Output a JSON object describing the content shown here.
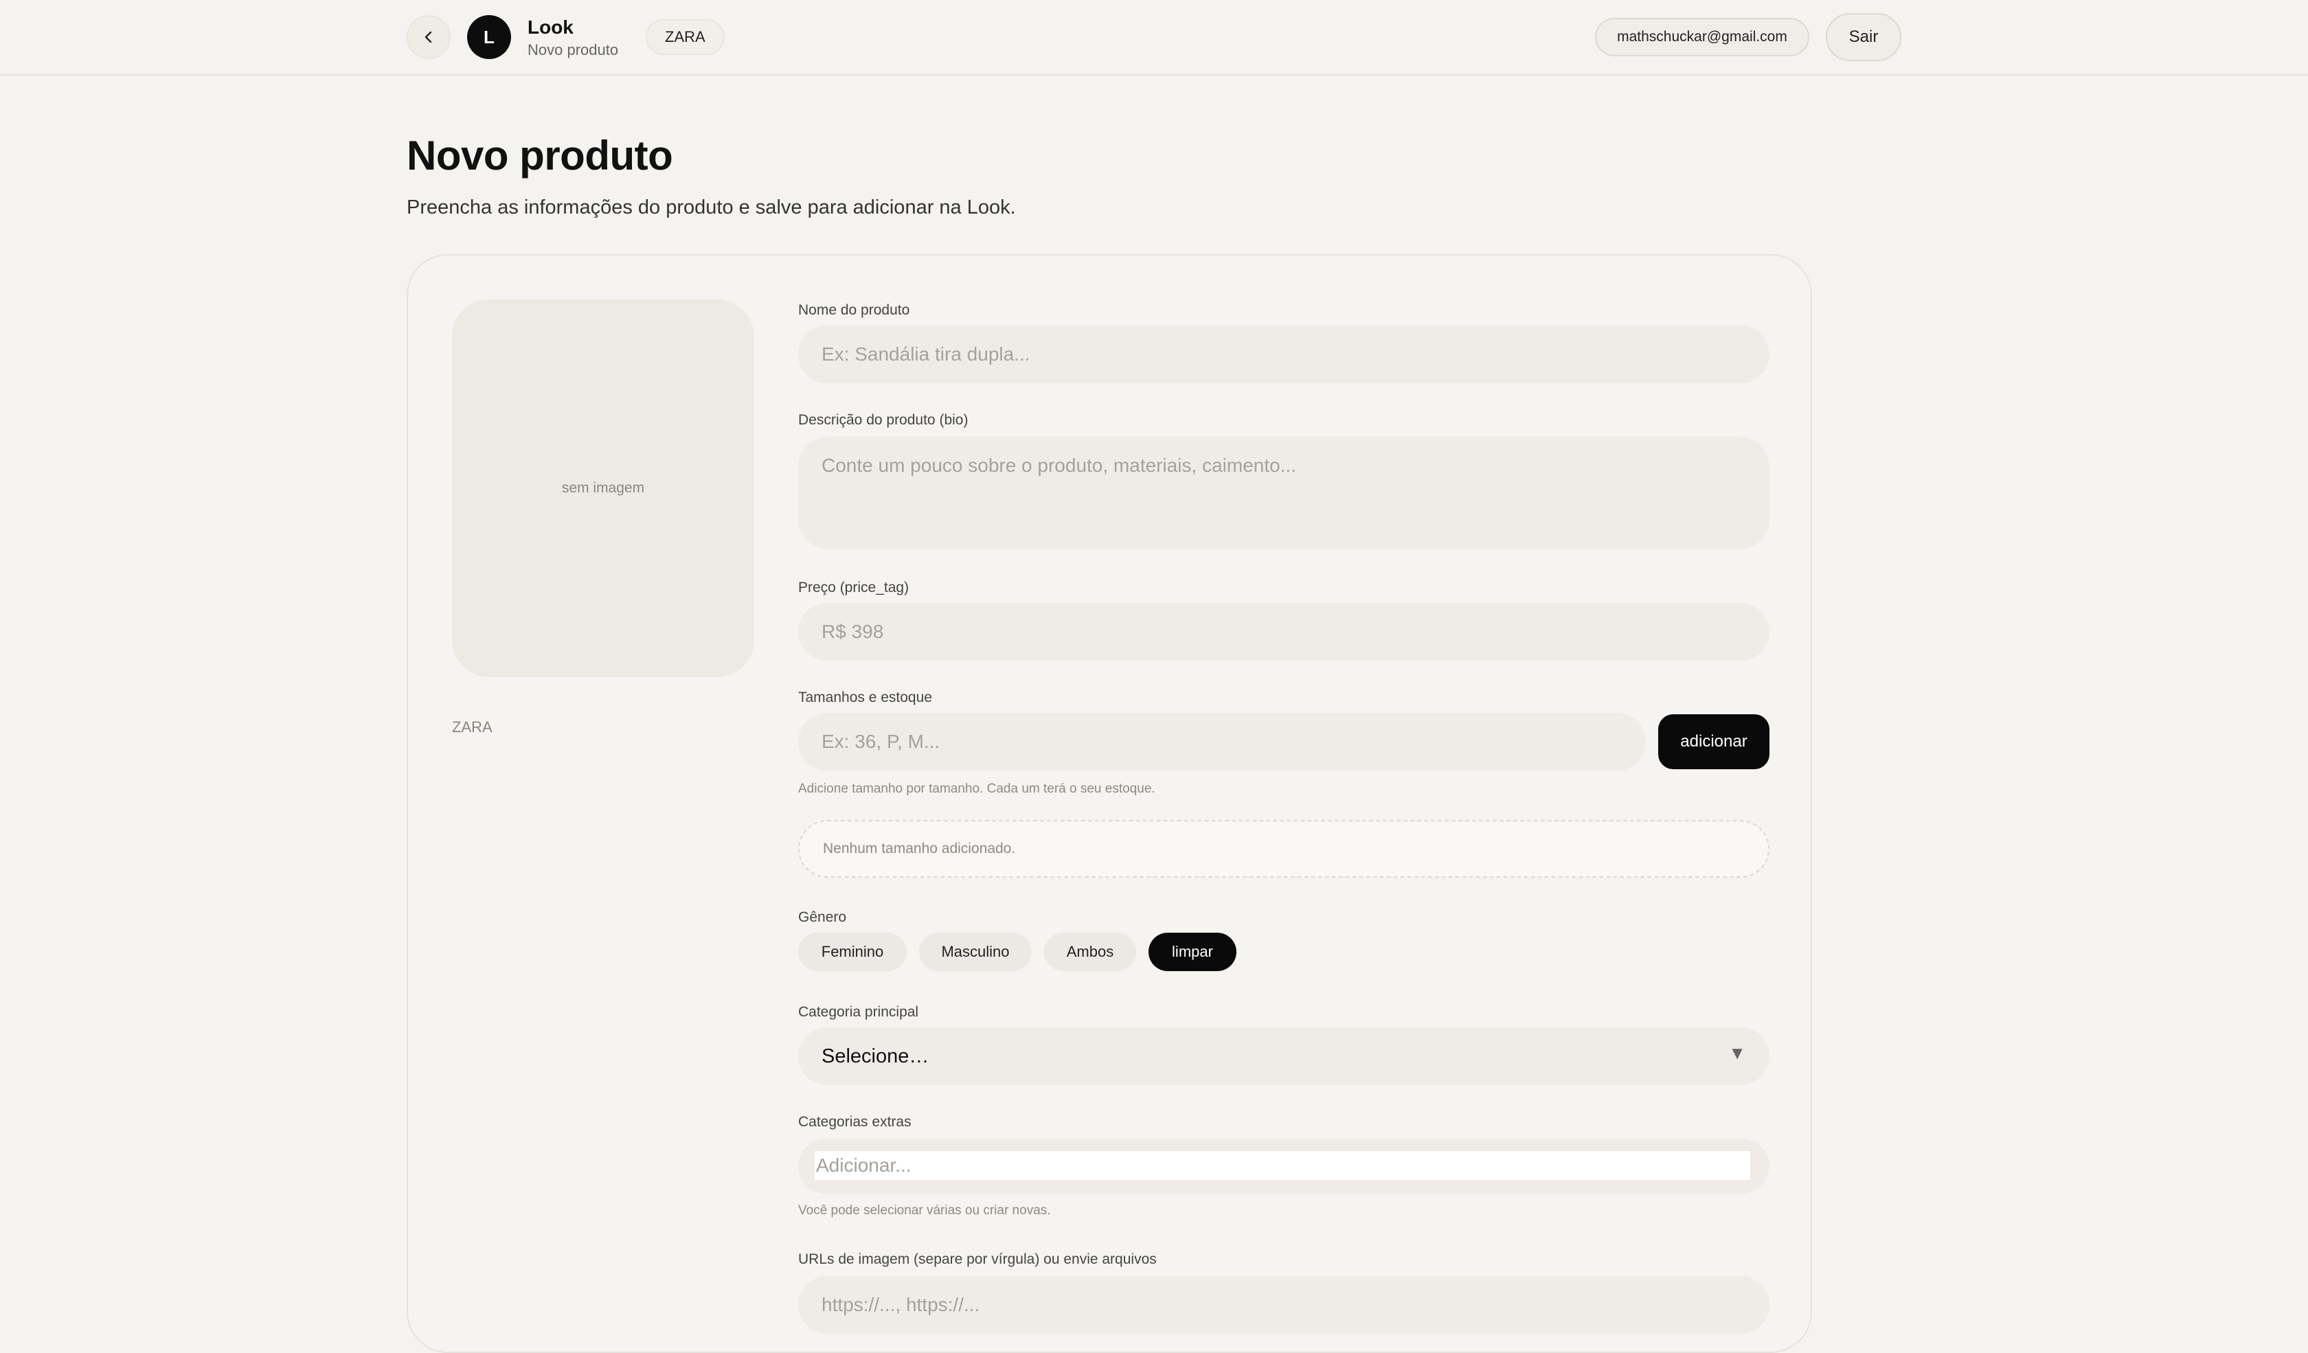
{
  "header": {
    "brand_initial": "L",
    "brand_title": "Look",
    "brand_subtitle": "Novo produto",
    "store_chip": "ZARA",
    "user_email": "mathschuckar@gmail.com",
    "logout_label": "Sair"
  },
  "page": {
    "title": "Novo produto",
    "subtitle": "Preencha as informações do produto e salve para adicionar na Look."
  },
  "preview": {
    "no_image_text": "sem imagem",
    "brand": "ZARA"
  },
  "form": {
    "name": {
      "label": "Nome do produto",
      "placeholder": "Ex: Sandália tira dupla..."
    },
    "description": {
      "label": "Descrição do produto (bio)",
      "placeholder": "Conte um pouco sobre o produto, materiais, caimento..."
    },
    "price": {
      "label": "Preço (price_tag)",
      "placeholder": "R$ 398"
    },
    "sizes": {
      "label": "Tamanhos e estoque",
      "placeholder": "Ex: 36, P, M...",
      "add_label": "adicionar",
      "helper": "Adicione tamanho por tamanho. Cada um terá o seu estoque.",
      "empty_text": "Nenhum tamanho adicionado."
    },
    "gender": {
      "label": "Gênero",
      "options": [
        "Feminino",
        "Masculino",
        "Ambos"
      ],
      "clear_label": "limpar"
    },
    "category": {
      "label": "Categoria principal",
      "selected": "Selecione…"
    },
    "extra_categories": {
      "label": "Categorias extras",
      "placeholder": "Adicionar...",
      "helper": "Você pode selecionar várias ou criar novas."
    },
    "image_urls": {
      "label": "URLs de imagem (separe por vírgula) ou envie arquivos",
      "placeholder": "https://..., https://..."
    }
  }
}
